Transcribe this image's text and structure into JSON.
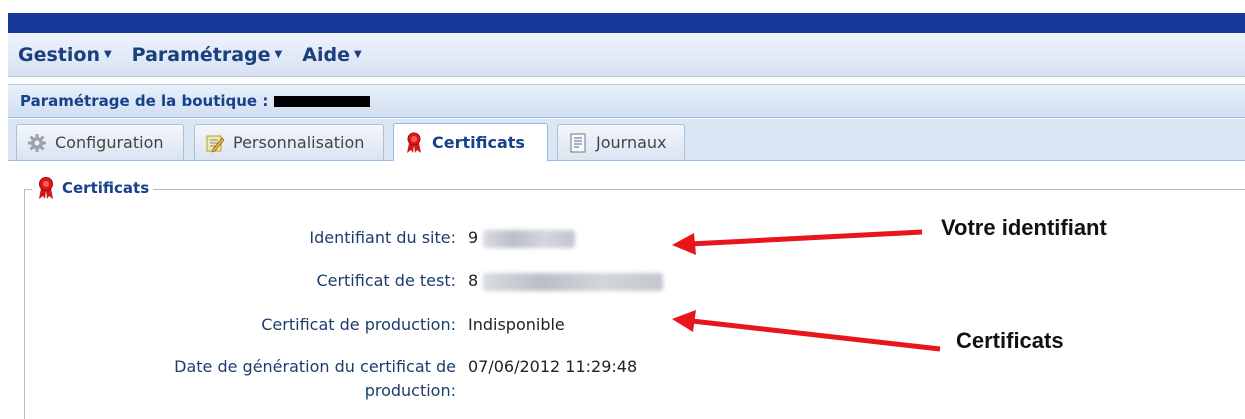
{
  "menu": {
    "items": [
      {
        "label": "Gestion"
      },
      {
        "label": "Paramétrage"
      },
      {
        "label": "Aide"
      }
    ]
  },
  "panel": {
    "title": "Paramétrage de la boutique :"
  },
  "tabs": [
    {
      "label": "Configuration",
      "icon": "gear-icon"
    },
    {
      "label": "Personnalisation",
      "icon": "edit-icon"
    },
    {
      "label": "Certificats",
      "icon": "ribbon-icon",
      "active": true
    },
    {
      "label": "Journaux",
      "icon": "document-icon"
    }
  ],
  "section": {
    "legend": "Certificats",
    "fields": {
      "site_id_label": "Identifiant du site:",
      "site_id_value": "9",
      "test_cert_label": "Certificat de test:",
      "test_cert_value": "8",
      "prod_cert_label": "Certificat de production:",
      "prod_cert_value": "Indisponible",
      "gen_date_label_line1": "Date de génération du certificat de",
      "gen_date_label_line2": "production:",
      "gen_date_value": "07/06/2012 11:29:48"
    }
  },
  "annotations": {
    "identifier": "Votre identifiant",
    "certificates": "Certificats",
    "arrow_color": "#e8151b"
  }
}
